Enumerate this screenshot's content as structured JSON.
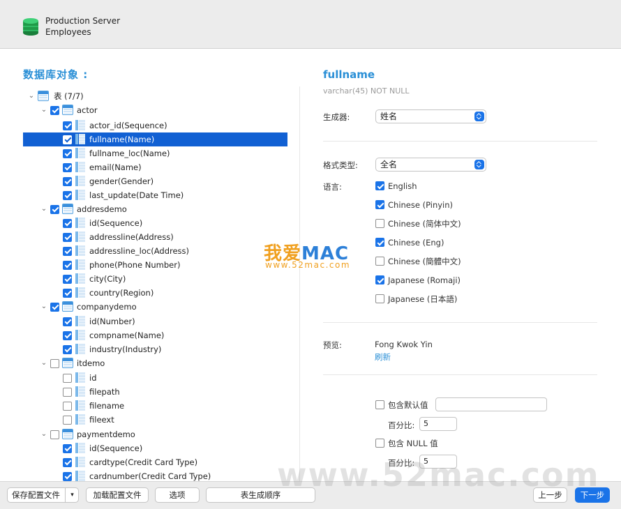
{
  "header": {
    "server": "Production Server",
    "database": "Employees"
  },
  "left": {
    "section_title": "数据库对象 :",
    "tree": [
      {
        "level": 0,
        "kind": "group",
        "label": "表 (7/7)",
        "expanded": true
      },
      {
        "level": 1,
        "kind": "table",
        "label": "actor",
        "checked": true,
        "expanded": true
      },
      {
        "level": 2,
        "kind": "field",
        "label": "actor_id(Sequence)",
        "checked": true
      },
      {
        "level": 2,
        "kind": "field",
        "label": "fullname(Name)",
        "checked": true,
        "selected": true
      },
      {
        "level": 2,
        "kind": "field",
        "label": "fullname_loc(Name)",
        "checked": true
      },
      {
        "level": 2,
        "kind": "field",
        "label": "email(Name)",
        "checked": true
      },
      {
        "level": 2,
        "kind": "field",
        "label": "gender(Gender)",
        "checked": true
      },
      {
        "level": 2,
        "kind": "field",
        "label": "last_update(Date Time)",
        "checked": true
      },
      {
        "level": 1,
        "kind": "table",
        "label": "addresdemo",
        "checked": true,
        "expanded": true
      },
      {
        "level": 2,
        "kind": "field",
        "label": "id(Sequence)",
        "checked": true
      },
      {
        "level": 2,
        "kind": "field",
        "label": "addressline(Address)",
        "checked": true
      },
      {
        "level": 2,
        "kind": "field",
        "label": "addressline_loc(Address)",
        "checked": true
      },
      {
        "level": 2,
        "kind": "field",
        "label": "phone(Phone Number)",
        "checked": true
      },
      {
        "level": 2,
        "kind": "field",
        "label": "city(City)",
        "checked": true
      },
      {
        "level": 2,
        "kind": "field",
        "label": "country(Region)",
        "checked": true
      },
      {
        "level": 1,
        "kind": "table",
        "label": "companydemo",
        "checked": true,
        "expanded": true
      },
      {
        "level": 2,
        "kind": "field",
        "label": "id(Number)",
        "checked": true
      },
      {
        "level": 2,
        "kind": "field",
        "label": "compname(Name)",
        "checked": true
      },
      {
        "level": 2,
        "kind": "field",
        "label": "industry(Industry)",
        "checked": true
      },
      {
        "level": 1,
        "kind": "table",
        "label": "itdemo",
        "checked": false,
        "expanded": true
      },
      {
        "level": 2,
        "kind": "field",
        "label": "id",
        "checked": false
      },
      {
        "level": 2,
        "kind": "field",
        "label": "filepath",
        "checked": false
      },
      {
        "level": 2,
        "kind": "field",
        "label": "filename",
        "checked": false
      },
      {
        "level": 2,
        "kind": "field",
        "label": "fileext",
        "checked": false
      },
      {
        "level": 1,
        "kind": "table",
        "label": "paymentdemo",
        "checked": false,
        "expanded": true
      },
      {
        "level": 2,
        "kind": "field",
        "label": "id(Sequence)",
        "checked": true
      },
      {
        "level": 2,
        "kind": "field",
        "label": "cardtype(Credit Card Type)",
        "checked": true
      },
      {
        "level": 2,
        "kind": "field",
        "label": "cardnumber(Credit Card Type)",
        "checked": true
      }
    ]
  },
  "right": {
    "field_title": "fullname",
    "field_type": "varchar(45) NOT NULL",
    "generator_label": "生成器:",
    "generator_value": "姓名",
    "format_label": "格式类型:",
    "format_value": "全名",
    "language_label": "语言:",
    "languages": [
      {
        "label": "English",
        "checked": true
      },
      {
        "label": "Chinese (Pinyin)",
        "checked": true
      },
      {
        "label": "Chinese (简体中文)",
        "checked": false
      },
      {
        "label": "Chinese (Eng)",
        "checked": true
      },
      {
        "label": "Chinese (簡體中文)",
        "checked": false
      },
      {
        "label": "Japanese (Romaji)",
        "checked": true
      },
      {
        "label": "Japanese (日本語)",
        "checked": false
      }
    ],
    "preview_label": "预览:",
    "preview_value": "Fong Kwok Yin",
    "refresh_label": "刷新",
    "include_default_label": "包含默认值",
    "include_default_checked": false,
    "default_value": "",
    "percent_label_1": "百分比:",
    "percent_value_1": "5",
    "include_null_label": "包含 NULL 值",
    "include_null_checked": false,
    "percent_label_2": "百分比:",
    "percent_value_2": "5"
  },
  "watermark": {
    "brand_cn": "我爱",
    "brand_en": "MAC",
    "url_small": "www.52mac.com",
    "url_big": "www.52mac.com"
  },
  "footer": {
    "save_config": "保存配置文件",
    "save_dropdown": "▾",
    "load_config": "加载配置文件",
    "options": "选项",
    "table_order": "表生成顺序",
    "prev": "上一步",
    "next": "下一步"
  }
}
